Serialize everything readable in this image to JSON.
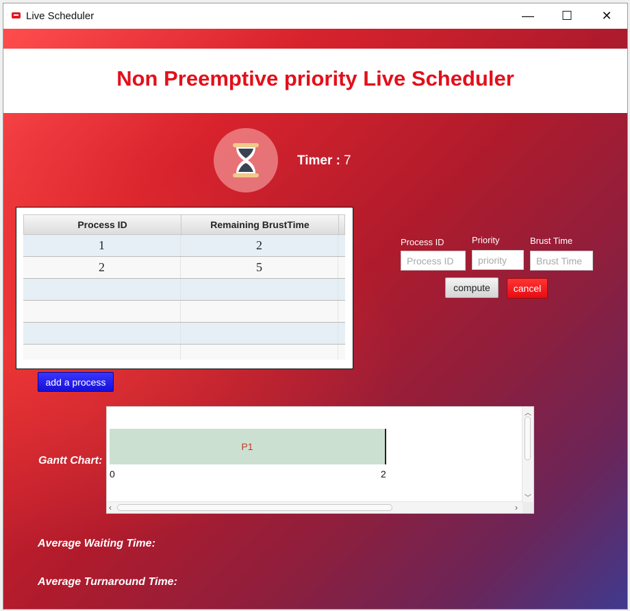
{
  "window": {
    "title": "Live Scheduler",
    "minimize": "—",
    "maximize": "☐",
    "close": "✕"
  },
  "header": {
    "title": "Non Preemptive priority Live Scheduler"
  },
  "timer": {
    "label": "Timer :",
    "value": "7"
  },
  "table": {
    "columns": [
      "Process ID",
      "Remaining BrustTime"
    ],
    "rows": [
      [
        "1",
        "2"
      ],
      [
        "2",
        "5"
      ],
      [
        "",
        ""
      ],
      [
        "",
        ""
      ],
      [
        "",
        ""
      ],
      [
        "",
        ""
      ]
    ]
  },
  "buttons": {
    "add_process": "add a process",
    "compute": "compute",
    "cancel": "cancel"
  },
  "form": {
    "process_id": {
      "label": "Process ID",
      "placeholder": "Process ID"
    },
    "priority": {
      "label": "Priority",
      "placeholder": "priority"
    },
    "brust_time": {
      "label": "Brust Time",
      "placeholder": "Brust Time"
    }
  },
  "gantt": {
    "label": "Gantt Chart:",
    "blocks": [
      {
        "name": "P1",
        "start": 0,
        "end": 2
      }
    ],
    "ticks": [
      "0",
      "2"
    ]
  },
  "stats": {
    "avg_waiting_label": "Average Waiting Time:",
    "avg_turnaround_label": "Average Turnaround Time:"
  },
  "colors": {
    "title_red": "#e2101b",
    "add_button_blue": "#1510d8",
    "cancel_red": "#e60c12",
    "gantt_block": "#cce0d1"
  },
  "icons": {
    "app": "app-icon",
    "timer": "hourglass-icon"
  }
}
